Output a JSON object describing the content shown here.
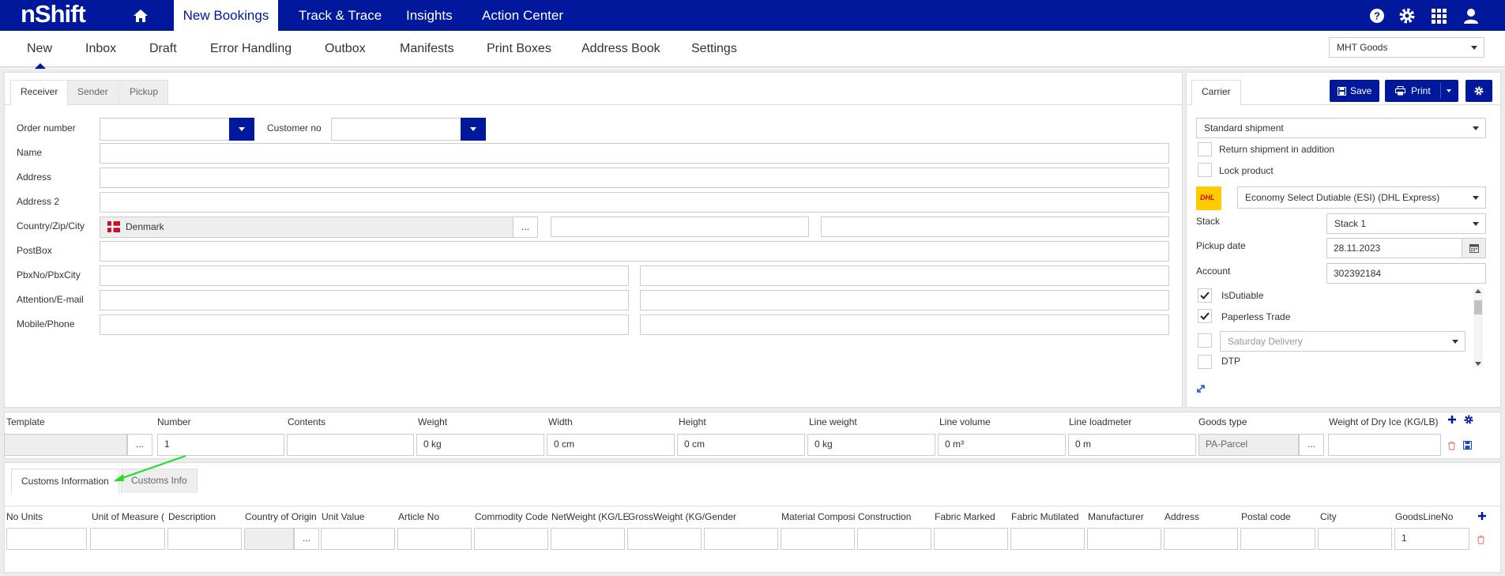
{
  "brand": {
    "logo": "nShift"
  },
  "topnav": {
    "items": [
      "New Bookings",
      "Track & Trace",
      "Insights",
      "Action Center"
    ]
  },
  "subnav": {
    "items": [
      "New",
      "Inbox",
      "Draft",
      "Error Handling",
      "Outbox",
      "Manifests",
      "Print Boxes",
      "Address Book",
      "Settings"
    ]
  },
  "profile_select": {
    "value": "MHT Goods"
  },
  "receiver": {
    "tabs": [
      "Receiver",
      "Sender",
      "Pickup"
    ],
    "labels": {
      "order_number": "Order number",
      "customer_no": "Customer no",
      "name": "Name",
      "address": "Address",
      "address2": "Address 2",
      "country_zip_city": "Country/Zip/City",
      "postbox": "PostBox",
      "pbx": "PbxNo/PbxCity",
      "attention": "Attention/E-mail",
      "mobile": "Mobile/Phone"
    },
    "country": "Denmark",
    "dots": "..."
  },
  "carrier": {
    "tab": "Carrier",
    "save_label": "Save",
    "print_label": "Print",
    "shipment_type": "Standard shipment",
    "return_shipment": "Return shipment in addition",
    "lock_product": "Lock product",
    "product": "Economy Select Dutiable (ESI) (DHL Express)",
    "stack_label": "Stack",
    "stack_value": "Stack 1",
    "pickup_label": "Pickup date",
    "pickup_value": "28.11.2023",
    "account_label": "Account",
    "account_value": "302392184",
    "services": {
      "is_dutiable": "IsDutiable",
      "paperless": "Paperless Trade",
      "saturday": "Saturday Delivery",
      "dtp": "DTP"
    },
    "carrier_logo": "DHL"
  },
  "goods": {
    "headers": [
      "Template",
      "Number",
      "Contents",
      "Weight",
      "Width",
      "Height",
      "Line weight",
      "Line volume",
      "Line loadmeter",
      "Goods type",
      "Weight of Dry Ice (KG/LB)"
    ],
    "row": {
      "dots": "...",
      "number": "1",
      "weight": "0 kg",
      "width": "0 cm",
      "height": "0 cm",
      "line_weight": "0 kg",
      "line_volume": "0 m³",
      "line_loadmeter": "0 m",
      "goods_type": "PA-Parcel",
      "goods_dots": "..."
    }
  },
  "customs": {
    "tabs": [
      "Customs Information",
      "Customs Info"
    ],
    "headers": [
      "No Units",
      "Unit of Measure (",
      "Description",
      "Country of Origin",
      "Unit Value",
      "Article No",
      "Commodity Code",
      "NetWeight (KG/LE",
      "GrossWeight (KG/",
      "Gender",
      "Material Composi",
      "Construction",
      "Fabric Marked",
      "Fabric Mutilated",
      "Manufacturer",
      "Address",
      "Postal code",
      "City",
      "GoodsLineNo"
    ],
    "row": {
      "dots": "...",
      "goods_line_no": "1"
    }
  },
  "colors": {
    "primary": "#00189c",
    "annotation_arrow": "#22dd22"
  }
}
